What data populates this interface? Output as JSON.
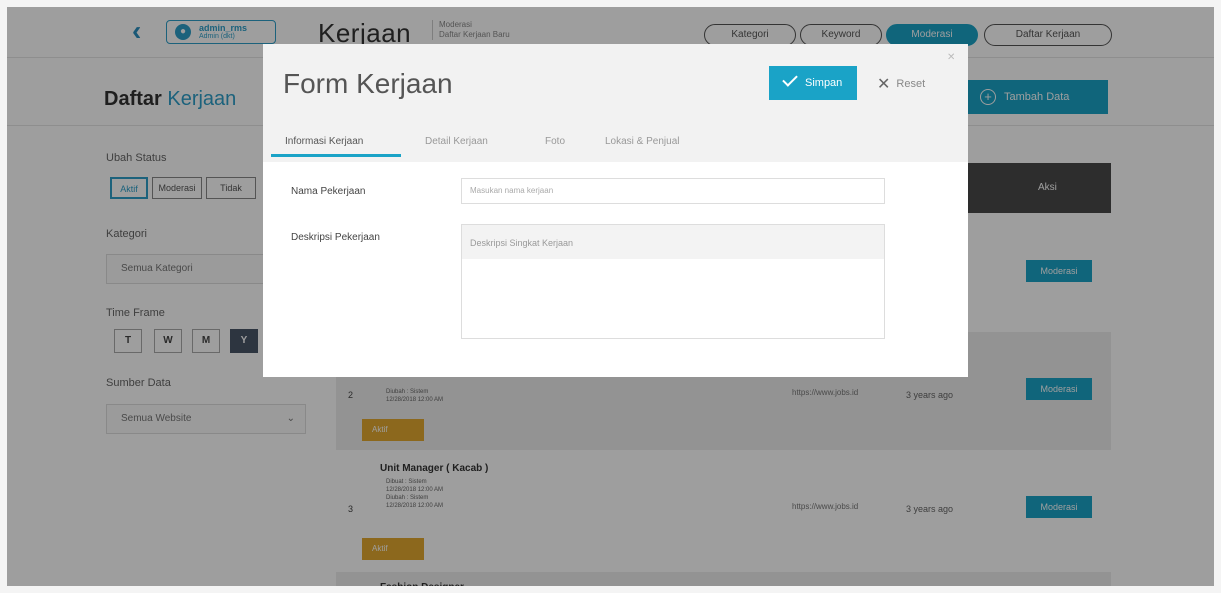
{
  "topbar": {
    "user_name": "admin_rms",
    "user_role": "Admin (dkt)",
    "title": "Kerjaan",
    "subtitle_line1": "Moderasi",
    "subtitle_line2": "Daftar Kerjaan Baru",
    "filters": [
      {
        "label": "Kategori",
        "active": false
      },
      {
        "label": "Keyword",
        "active": false
      },
      {
        "label": "Moderasi",
        "active": true
      },
      {
        "label": "Daftar Kerjaan",
        "active": false
      }
    ]
  },
  "subheader": {
    "title_bold": "Daftar",
    "title_light": "Kerjaan",
    "add_button": "Tambah Data"
  },
  "sidebar": {
    "status_label": "Ubah Status",
    "status_buttons": [
      "Aktif",
      "Moderasi",
      "Tidak"
    ],
    "kategori_label": "Kategori",
    "kategori_placeholder": "Semua Kategori",
    "timeframe_label": "Time Frame",
    "timeframe_buttons": [
      "T",
      "W",
      "M",
      "Y"
    ],
    "sumber_label": "Sumber Data",
    "sumber_placeholder": "Semua Website"
  },
  "table": {
    "aksi_header": "Aksi",
    "moderasi_label": "Moderasi",
    "aktif_label": "Aktif",
    "rows": [
      {
        "num": "2",
        "title": "",
        "meta1": "Diubah : Sistem",
        "meta2": "12/28/2018 12:00 AM",
        "link": "https://www.jobs.id",
        "time": "3 years ago"
      },
      {
        "num": "3",
        "title": "Unit Manager ( Kacab )",
        "meta1": "Dibuat : Sistem",
        "meta2": "12/28/2018 12:00 AM",
        "meta3": "Diubah : Sistem",
        "meta4": "12/28/2018 12:00 AM",
        "link": "https://www.jobs.id",
        "time": "3 years ago"
      },
      {
        "num": "",
        "title": "Fashion Designer"
      }
    ]
  },
  "modal": {
    "title": "Form Kerjaan",
    "save_label": "Simpan",
    "reset_label": "Reset",
    "tabs": [
      "Informasi Kerjaan",
      "Detail Kerjaan",
      "Foto",
      "Lokasi & Penjual"
    ],
    "fields": {
      "nama_label": "Nama Pekerjaan",
      "nama_placeholder": "Masukan nama kerjaan",
      "deskripsi_label": "Deskripsi Pekerjaan",
      "deskripsi_placeholder": "Deskripsi Singkat Kerjaan"
    }
  }
}
